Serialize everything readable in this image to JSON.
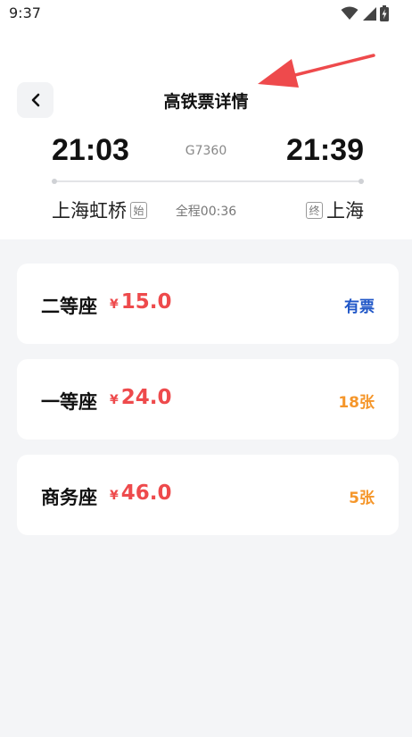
{
  "status_bar": {
    "time": "9:37",
    "icons": [
      "wifi-icon",
      "signal-icon",
      "battery-charging-icon"
    ]
  },
  "header": {
    "title": "高铁票详情",
    "back_icon": "chevron-left-icon"
  },
  "trip": {
    "departure_time": "21:03",
    "arrival_time": "21:39",
    "train_number": "G7360",
    "departure_station": "上海虹桥",
    "departure_tag": "始",
    "arrival_station": "上海",
    "arrival_tag": "终",
    "duration": "全程00:36"
  },
  "seats": [
    {
      "name": "二等座",
      "currency": "¥",
      "price": "15.0",
      "availability": "有票"
    },
    {
      "name": "一等座",
      "currency": "¥",
      "price": "24.0",
      "availability": "18张"
    },
    {
      "name": "商务座",
      "currency": "¥",
      "price": "46.0",
      "availability": "5张"
    }
  ],
  "colors": {
    "price": "#ee4a4c",
    "available": "#1f56c7",
    "count": "#f5962a",
    "annotation_arrow": "#ee4a4c"
  }
}
